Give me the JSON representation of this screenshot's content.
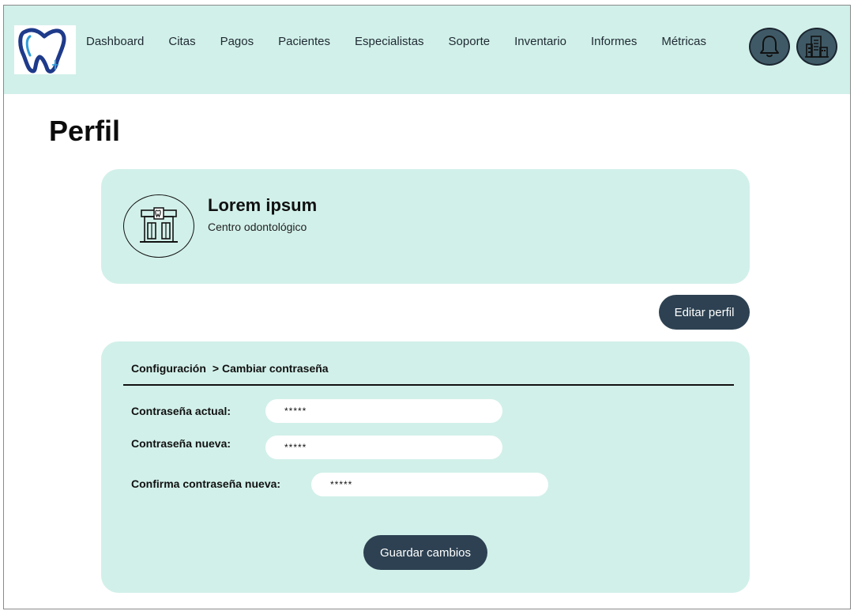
{
  "nav": {
    "items": [
      {
        "label": "Dashboard"
      },
      {
        "label": "Citas"
      },
      {
        "label": "Pagos"
      },
      {
        "label": "Pacientes"
      },
      {
        "label": "Especialistas"
      },
      {
        "label": "Soporte"
      },
      {
        "label": "Inventario"
      },
      {
        "label": "Informes"
      },
      {
        "label": "Métricas"
      }
    ],
    "icons": [
      "tooth-logo-icon",
      "bell-icon",
      "building-icon"
    ]
  },
  "page": {
    "title": "Perfil"
  },
  "profile": {
    "name": "Lorem ipsum",
    "subtitle": "Centro odontológico",
    "avatar_icon": "dental-clinic-icon",
    "edit_label": "Editar perfil"
  },
  "settings": {
    "breadcrumb": [
      "Configuración",
      "> Cambiar contraseña"
    ],
    "fields": {
      "current": {
        "label": "Contraseña actual:",
        "value": "*****"
      },
      "new": {
        "label": "Contraseña nueva:",
        "value": "*****"
      },
      "confirm": {
        "label": "Confirma contraseña nueva:",
        "value": "*****"
      }
    },
    "save_label": "Guardar cambios"
  },
  "colors": {
    "accent_mint": "#d1f0e9",
    "button_dark": "#2d4152",
    "icon_circle": "#3f5a66",
    "logo_blue": "#1e3a8a"
  }
}
